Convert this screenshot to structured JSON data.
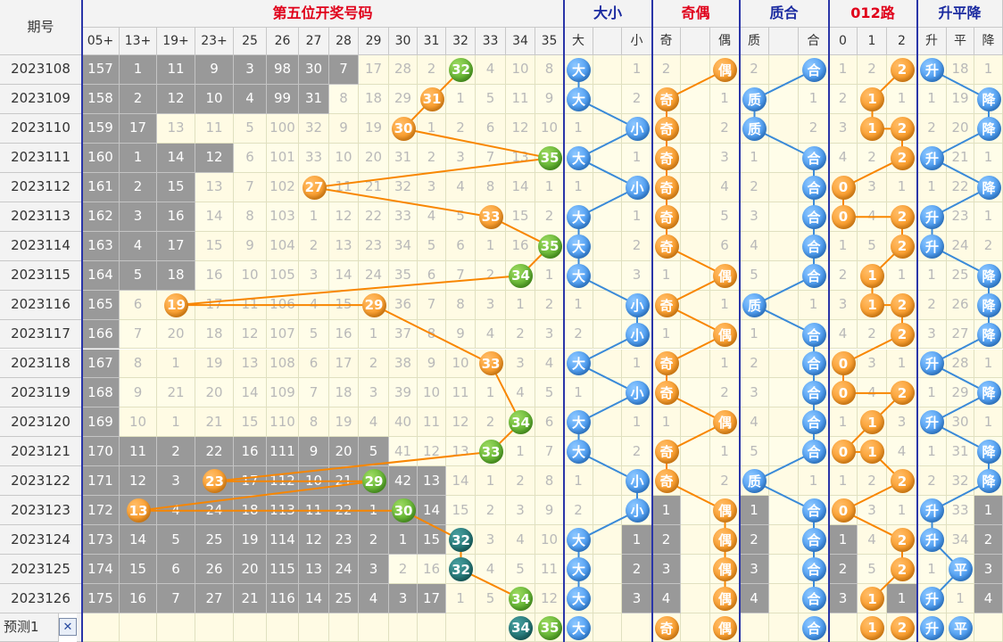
{
  "header": {
    "period_label": "期号",
    "pos5_title": "第五位开奖号码",
    "daxiao_title": "大小",
    "jiou_title": "奇偶",
    "zhihe_title": "质合",
    "lu_title": "012路",
    "sheng_title": "升平降"
  },
  "sub": {
    "pos5": [
      "05+",
      "13+",
      "19+",
      "23+",
      "25",
      "26",
      "27",
      "28",
      "29",
      "30",
      "31",
      "32",
      "33",
      "34",
      "35"
    ],
    "daxiao": [
      "大",
      "",
      "小"
    ],
    "jiou": [
      "奇",
      "",
      "偶"
    ],
    "zhihe": [
      "质",
      "",
      "合"
    ],
    "lu": [
      "0",
      "1",
      "2"
    ],
    "sheng": [
      "升",
      "平",
      "降"
    ]
  },
  "rows": [
    {
      "period": "2023108",
      "pos5": [
        "157",
        "1",
        "11",
        "9",
        "3",
        "98",
        "30",
        "7",
        "17",
        "28",
        "2",
        "32",
        "4",
        "10",
        "8"
      ],
      "daxiao": [
        "大",
        "",
        "1"
      ],
      "jiou": [
        "2",
        "",
        "偶"
      ],
      "zhihe": [
        "2",
        "",
        "合"
      ],
      "lu": [
        "1",
        "2",
        "2"
      ],
      "sheng": [
        "升",
        "18",
        "1"
      ]
    },
    {
      "period": "2023109",
      "pos5": [
        "158",
        "2",
        "12",
        "10",
        "4",
        "99",
        "31",
        "8",
        "18",
        "29",
        "31",
        "1",
        "5",
        "11",
        "9"
      ],
      "daxiao": [
        "大",
        "",
        "2"
      ],
      "jiou": [
        "奇",
        "",
        "1"
      ],
      "zhihe": [
        "质",
        "",
        "1"
      ],
      "lu": [
        "2",
        "1",
        "1"
      ],
      "sheng": [
        "1",
        "19",
        "降"
      ]
    },
    {
      "period": "2023110",
      "pos5": [
        "159",
        "17",
        "13",
        "11",
        "5",
        "100",
        "32",
        "9",
        "19",
        "30",
        "1",
        "2",
        "6",
        "12",
        "10"
      ],
      "daxiao": [
        "1",
        "",
        "小"
      ],
      "jiou": [
        "奇",
        "",
        "2"
      ],
      "zhihe": [
        "质",
        "",
        "2"
      ],
      "lu": [
        "3",
        "1",
        "2"
      ],
      "sheng": [
        "2",
        "20",
        "降"
      ]
    },
    {
      "period": "2023111",
      "pos5": [
        "160",
        "1",
        "14",
        "12",
        "6",
        "101",
        "33",
        "10",
        "20",
        "31",
        "2",
        "3",
        "7",
        "13",
        "35"
      ],
      "daxiao": [
        "大",
        "",
        "1"
      ],
      "jiou": [
        "奇",
        "",
        "3"
      ],
      "zhihe": [
        "1",
        "",
        "合"
      ],
      "lu": [
        "4",
        "2",
        "2"
      ],
      "sheng": [
        "升",
        "21",
        "1"
      ]
    },
    {
      "period": "2023112",
      "pos5": [
        "161",
        "2",
        "15",
        "13",
        "7",
        "102",
        "27",
        "11",
        "21",
        "32",
        "3",
        "4",
        "8",
        "14",
        "1"
      ],
      "daxiao": [
        "1",
        "",
        "小"
      ],
      "jiou": [
        "奇",
        "",
        "4"
      ],
      "zhihe": [
        "2",
        "",
        "合"
      ],
      "lu": [
        "0",
        "3",
        "1"
      ],
      "sheng": [
        "1",
        "22",
        "降"
      ]
    },
    {
      "period": "2023113",
      "pos5": [
        "162",
        "3",
        "16",
        "14",
        "8",
        "103",
        "1",
        "12",
        "22",
        "33",
        "4",
        "5",
        "33",
        "15",
        "2"
      ],
      "daxiao": [
        "大",
        "",
        "1"
      ],
      "jiou": [
        "奇",
        "",
        "5"
      ],
      "zhihe": [
        "3",
        "",
        "合"
      ],
      "lu": [
        "0",
        "4",
        "2"
      ],
      "sheng": [
        "升",
        "23",
        "1"
      ]
    },
    {
      "period": "2023114",
      "pos5": [
        "163",
        "4",
        "17",
        "15",
        "9",
        "104",
        "2",
        "13",
        "23",
        "34",
        "5",
        "6",
        "1",
        "16",
        "35"
      ],
      "daxiao": [
        "大",
        "",
        "2"
      ],
      "jiou": [
        "奇",
        "",
        "6"
      ],
      "zhihe": [
        "4",
        "",
        "合"
      ],
      "lu": [
        "1",
        "5",
        "2"
      ],
      "sheng": [
        "升",
        "24",
        "2"
      ]
    },
    {
      "period": "2023115",
      "pos5": [
        "164",
        "5",
        "18",
        "16",
        "10",
        "105",
        "3",
        "14",
        "24",
        "35",
        "6",
        "7",
        "2",
        "34",
        "1"
      ],
      "daxiao": [
        "大",
        "",
        "3"
      ],
      "jiou": [
        "1",
        "",
        "偶"
      ],
      "zhihe": [
        "5",
        "",
        "合"
      ],
      "lu": [
        "2",
        "1",
        "1"
      ],
      "sheng": [
        "1",
        "25",
        "降"
      ]
    },
    {
      "period": "2023116",
      "pos5": [
        "165",
        "6",
        "19",
        "17",
        "11",
        "106",
        "4",
        "15",
        "29",
        "36",
        "7",
        "8",
        "3",
        "1",
        "2"
      ],
      "daxiao": [
        "1",
        "",
        "小"
      ],
      "jiou": [
        "奇",
        "",
        "1"
      ],
      "zhihe": [
        "质",
        "",
        "1"
      ],
      "lu": [
        "3",
        "1",
        "2"
      ],
      "sheng": [
        "2",
        "26",
        "降"
      ]
    },
    {
      "period": "2023117",
      "pos5": [
        "166",
        "7",
        "20",
        "18",
        "12",
        "107",
        "5",
        "16",
        "1",
        "37",
        "8",
        "9",
        "4",
        "2",
        "3"
      ],
      "daxiao": [
        "2",
        "",
        "小"
      ],
      "jiou": [
        "1",
        "",
        "偶"
      ],
      "zhihe": [
        "1",
        "",
        "合"
      ],
      "lu": [
        "4",
        "2",
        "2"
      ],
      "sheng": [
        "3",
        "27",
        "降"
      ]
    },
    {
      "period": "2023118",
      "pos5": [
        "167",
        "8",
        "1",
        "19",
        "13",
        "108",
        "6",
        "17",
        "2",
        "38",
        "9",
        "10",
        "33",
        "3",
        "4"
      ],
      "daxiao": [
        "大",
        "",
        "1"
      ],
      "jiou": [
        "奇",
        "",
        "1"
      ],
      "zhihe": [
        "2",
        "",
        "合"
      ],
      "lu": [
        "0",
        "3",
        "1"
      ],
      "sheng": [
        "升",
        "28",
        "1"
      ]
    },
    {
      "period": "2023119",
      "pos5": [
        "168",
        "9",
        "21",
        "20",
        "14",
        "109",
        "7",
        "18",
        "3",
        "39",
        "10",
        "11",
        "1",
        "4",
        "5"
      ],
      "daxiao": [
        "1",
        "",
        "小"
      ],
      "jiou": [
        "奇",
        "",
        "2"
      ],
      "zhihe": [
        "3",
        "",
        "合"
      ],
      "lu": [
        "0",
        "4",
        "2"
      ],
      "sheng": [
        "1",
        "29",
        "降"
      ]
    },
    {
      "period": "2023120",
      "pos5": [
        "169",
        "10",
        "1",
        "21",
        "15",
        "110",
        "8",
        "19",
        "4",
        "40",
        "11",
        "12",
        "2",
        "34",
        "6"
      ],
      "daxiao": [
        "大",
        "",
        "1"
      ],
      "jiou": [
        "1",
        "",
        "偶"
      ],
      "zhihe": [
        "4",
        "",
        "合"
      ],
      "lu": [
        "1",
        "1",
        "3"
      ],
      "sheng": [
        "升",
        "30",
        "1"
      ]
    },
    {
      "period": "2023121",
      "pos5": [
        "170",
        "11",
        "2",
        "22",
        "16",
        "111",
        "9",
        "20",
        "5",
        "41",
        "12",
        "13",
        "33",
        "1",
        "7"
      ],
      "daxiao": [
        "大",
        "",
        "2"
      ],
      "jiou": [
        "奇",
        "",
        "1"
      ],
      "zhihe": [
        "5",
        "",
        "合"
      ],
      "lu": [
        "0",
        "1",
        "4"
      ],
      "sheng": [
        "1",
        "31",
        "降"
      ]
    },
    {
      "period": "2023122",
      "pos5": [
        "171",
        "12",
        "3",
        "23",
        "17",
        "112",
        "10",
        "21",
        "29",
        "42",
        "13",
        "14",
        "1",
        "2",
        "8"
      ],
      "daxiao": [
        "1",
        "",
        "小"
      ],
      "jiou": [
        "奇",
        "",
        "2"
      ],
      "zhihe": [
        "质",
        "",
        "1"
      ],
      "lu": [
        "1",
        "2",
        "2"
      ],
      "sheng": [
        "2",
        "32",
        "降"
      ]
    },
    {
      "period": "2023123",
      "pos5": [
        "172",
        "13",
        "4",
        "24",
        "18",
        "113",
        "11",
        "22",
        "1",
        "30",
        "14",
        "15",
        "2",
        "3",
        "9"
      ],
      "daxiao": [
        "2",
        "",
        "小"
      ],
      "jiou": [
        "1",
        "",
        "偶"
      ],
      "zhihe": [
        "1",
        "",
        "合"
      ],
      "lu": [
        "0",
        "3",
        "1"
      ],
      "sheng": [
        "升",
        "33",
        "1"
      ]
    },
    {
      "period": "2023124",
      "pos5": [
        "173",
        "14",
        "5",
        "25",
        "19",
        "114",
        "12",
        "23",
        "2",
        "1",
        "15",
        "32",
        "3",
        "4",
        "10"
      ],
      "daxiao": [
        "大",
        "",
        "1"
      ],
      "jiou": [
        "2",
        "",
        "偶"
      ],
      "zhihe": [
        "2",
        "",
        "合"
      ],
      "lu": [
        "1",
        "4",
        "2"
      ],
      "sheng": [
        "升",
        "34",
        "2"
      ]
    },
    {
      "period": "2023125",
      "pos5": [
        "174",
        "15",
        "6",
        "26",
        "20",
        "115",
        "13",
        "24",
        "3",
        "2",
        "16",
        "32",
        "4",
        "5",
        "11"
      ],
      "daxiao": [
        "大",
        "",
        "2"
      ],
      "jiou": [
        "3",
        "",
        "偶"
      ],
      "zhihe": [
        "3",
        "",
        "合"
      ],
      "lu": [
        "2",
        "5",
        "2"
      ],
      "sheng": [
        "1",
        "平",
        "3"
      ]
    },
    {
      "period": "2023126",
      "pos5": [
        "175",
        "16",
        "7",
        "27",
        "21",
        "116",
        "14",
        "25",
        "4",
        "3",
        "17",
        "1",
        "5",
        "34",
        "12"
      ],
      "daxiao": [
        "大",
        "",
        "3"
      ],
      "jiou": [
        "4",
        "",
        "偶"
      ],
      "zhihe": [
        "4",
        "",
        "合"
      ],
      "lu": [
        "3",
        "1",
        "1"
      ],
      "sheng": [
        "升",
        "1",
        "4"
      ]
    }
  ],
  "predict": {
    "label": "预测1",
    "close_glyph": "✕",
    "pos5": [
      "",
      "",
      "",
      "",
      "",
      "",
      "",
      "",
      "",
      "",
      "",
      "",
      "",
      "34",
      "35"
    ],
    "daxiao": [
      "大",
      "",
      ""
    ],
    "jiou": [
      "奇",
      "",
      "偶"
    ],
    "zhihe": [
      "",
      "",
      "合"
    ],
    "lu": [
      "",
      "1",
      "2"
    ],
    "sheng": [
      "升",
      "平",
      ""
    ]
  },
  "colors": {
    "orange": "#f88600",
    "green": "#3c9a12",
    "teal": "#0d5a5a",
    "blue": "#1f7ee8",
    "title_red": "#e0001a",
    "title_blue": "#1a2aa0",
    "divider": "#2a35a8",
    "grey_cell": "#999999",
    "gray_text": "#b9b9b9"
  }
}
